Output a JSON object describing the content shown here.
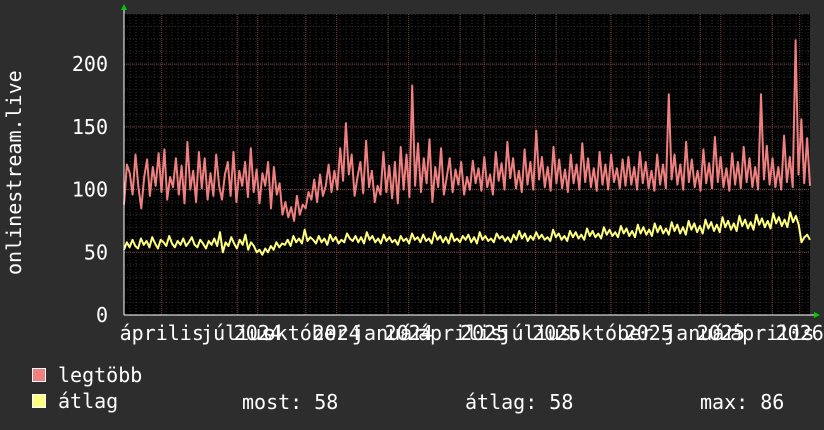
{
  "chart_data": {
    "type": "line",
    "title": "",
    "ylabel": "onlinestream.live",
    "ylim": [
      0,
      240
    ],
    "yticks": [
      0,
      50,
      100,
      150,
      200
    ],
    "xticks": [
      {
        "label": "április",
        "x": 0.055
      },
      {
        "label": "július",
        "x": 0.165
      },
      {
        "label": "2024",
        "x": 0.195
      },
      {
        "label": "október",
        "x": 0.265
      },
      {
        "label": "2024",
        "x": 0.31
      },
      {
        "label": "január",
        "x": 0.385
      },
      {
        "label": "2024",
        "x": 0.415
      },
      {
        "label": "április",
        "x": 0.49
      },
      {
        "label": "2025",
        "x": 0.525
      },
      {
        "label": "július",
        "x": 0.6
      },
      {
        "label": "2025",
        "x": 0.63
      },
      {
        "label": "október",
        "x": 0.71
      },
      {
        "label": "2025",
        "x": 0.765
      },
      {
        "label": "január",
        "x": 0.84
      },
      {
        "label": "2025",
        "x": 0.87
      },
      {
        "label": "április",
        "x": 0.945
      },
      {
        "label": "2026",
        "x": 0.985
      }
    ],
    "grid": true,
    "series": [
      {
        "name": "legtöbb",
        "color": "#f08080",
        "values": [
          88,
          120,
          113,
          96,
          128,
          102,
          85,
          110,
          124,
          95,
          118,
          103,
          129,
          98,
          132,
          92,
          110,
          102,
          125,
          96,
          119,
          89,
          138,
          100,
          115,
          90,
          130,
          101,
          125,
          92,
          113,
          95,
          128,
          103,
          92,
          112,
          122,
          95,
          130,
          90,
          115,
          103,
          122,
          94,
          133,
          98,
          116,
          89,
          113,
          103,
          122,
          85,
          118,
          96,
          105,
          80,
          90,
          78,
          86,
          75,
          95,
          80,
          88,
          85,
          98,
          92,
          108,
          90,
          112,
          95,
          103,
          120,
          98,
          115,
          100,
          133,
          107,
          153,
          112,
          128,
          95,
          110,
          122,
          97,
          139,
          102,
          115,
          90,
          103,
          96,
          130,
          98,
          119,
          93,
          122,
          89,
          134,
          100,
          128,
          94,
          183,
          103,
          137,
          98,
          125,
          105,
          140,
          90,
          118,
          102,
          133,
          96,
          110,
          125,
          98,
          116,
          104,
          122,
          96,
          110,
          100,
          123,
          105,
          117,
          99,
          126,
          102,
          112,
          96,
          130,
          107,
          121,
          100,
          138,
          109,
          125,
          101,
          115,
          98,
          132,
          104,
          122,
          100,
          147,
          108,
          126,
          102,
          118,
          99,
          134,
          105,
          124,
          101,
          116,
          98,
          128,
          105,
          120,
          100,
          137,
          106,
          125,
          102,
          117,
          99,
          130,
          104,
          120,
          100,
          128,
          106,
          117,
          101,
          124,
          103,
          126,
          104,
          118,
          100,
          130,
          105,
          122,
          101,
          115,
          99,
          128,
          104,
          120,
          101,
          176,
          108,
          128,
          104,
          120,
          100,
          138,
          106,
          124,
          102,
          115,
          99,
          132,
          105,
          121,
          101,
          142,
          106,
          126,
          102,
          117,
          99,
          129,
          104,
          122,
          101,
          134,
          106,
          125,
          102,
          118,
          100,
          176,
          108,
          135,
          104,
          125,
          102,
          118,
          100,
          143,
          106,
          126,
          102,
          219,
          112,
          156,
          105,
          141,
          103
        ],
        "marks": [
          {
            "text": "■",
            "name": "legend-swatch-legtobb"
          }
        ]
      },
      {
        "name": "átlag",
        "color": "#ffff80",
        "values": [
          52,
          58,
          54,
          60,
          55,
          53,
          61,
          56,
          59,
          54,
          62,
          57,
          53,
          60,
          58,
          55,
          63,
          57,
          54,
          59,
          56,
          61,
          55,
          58,
          62,
          56,
          54,
          60,
          57,
          53,
          59,
          56,
          61,
          55,
          66,
          50,
          58,
          55,
          62,
          57,
          53,
          60,
          56,
          64,
          52,
          58,
          55,
          50,
          52,
          48,
          53,
          50,
          55,
          52,
          58,
          54,
          57,
          56,
          60,
          55,
          63,
          58,
          61,
          57,
          68,
          59,
          62,
          60,
          57,
          63,
          58,
          61,
          56,
          64,
          59,
          62,
          57,
          60,
          58,
          65,
          61,
          59,
          63,
          58,
          62,
          57,
          66,
          60,
          63,
          58,
          61,
          57,
          64,
          59,
          62,
          58,
          60,
          56,
          63,
          59,
          61,
          57,
          65,
          60,
          62,
          58,
          64,
          59,
          61,
          57,
          66,
          60,
          63,
          58,
          62,
          57,
          65,
          59,
          61,
          58,
          63,
          60,
          64,
          58,
          62,
          57,
          66,
          60,
          63,
          59,
          61,
          58,
          65,
          61,
          63,
          59,
          62,
          58,
          64,
          60,
          67,
          61,
          65,
          59,
          63,
          60,
          66,
          61,
          64,
          60,
          62,
          59,
          68,
          62,
          65,
          60,
          63,
          59,
          67,
          62,
          66,
          61,
          64,
          60,
          69,
          63,
          67,
          62,
          65,
          61,
          70,
          64,
          68,
          63,
          66,
          62,
          71,
          65,
          69,
          63,
          67,
          62,
          72,
          65,
          70,
          64,
          68,
          63,
          73,
          66,
          71,
          65,
          69,
          64,
          74,
          67,
          72,
          65,
          70,
          64,
          75,
          68,
          73,
          66,
          71,
          65,
          76,
          69,
          74,
          67,
          72,
          66,
          78,
          70,
          75,
          68,
          73,
          67,
          79,
          71,
          76,
          69,
          74,
          68,
          80,
          72,
          77,
          70,
          75,
          69,
          81,
          73,
          78,
          71,
          76,
          70,
          82,
          74,
          79,
          72,
          58,
          62,
          64,
          60
        ],
        "marks": [
          {
            "text": "■",
            "name": "legend-swatch-atlag"
          }
        ]
      }
    ]
  },
  "legend": {
    "items": [
      {
        "label": "legtöbb",
        "color": "#f08080"
      },
      {
        "label": "átlag",
        "color": "#ffff80"
      }
    ],
    "stats": {
      "now_label": "most: 58",
      "avg_label": "átlag: 58",
      "max_label": "max: 86"
    }
  }
}
